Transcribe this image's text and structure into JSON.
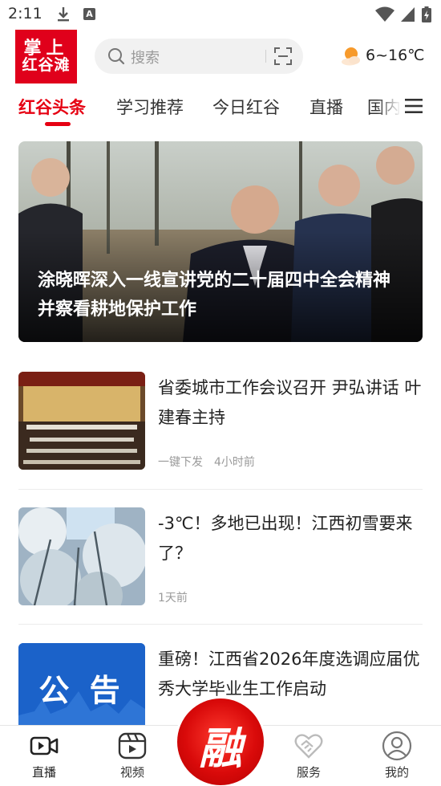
{
  "status_bar": {
    "time": "2:11"
  },
  "header": {
    "logo_line1": "掌上",
    "logo_line2": "红谷滩",
    "search_placeholder": "搜索",
    "weather": "6~16℃"
  },
  "tabs": [
    {
      "label": "红谷头条",
      "active": true
    },
    {
      "label": "学习推荐",
      "active": false
    },
    {
      "label": "今日红谷",
      "active": false
    },
    {
      "label": "直播",
      "active": false
    },
    {
      "label": "国内",
      "active": false
    }
  ],
  "hero": {
    "title": "涂晓晖深入一线宣讲党的二十届四中全会精神并察看耕地保护工作"
  },
  "news": [
    {
      "title": "省委城市工作会议召开 尹弘讲话 叶建春主持",
      "source": "一键下发",
      "time": "4小时前"
    },
    {
      "title": "-3℃！多地已出现！江西初雪要来了？",
      "source": "",
      "time": "1天前"
    },
    {
      "title": "重磅！江西省2026年度选调应届优秀大学毕业生工作启动",
      "source": "",
      "time": ""
    }
  ],
  "news3_thumb_text": "公 告",
  "bottom_nav": {
    "live": "直播",
    "video": "视频",
    "center": "融",
    "service": "服务",
    "mine": "我的"
  },
  "colors": {
    "brand_red": "#e60012",
    "logo_red": "#e0001b"
  }
}
